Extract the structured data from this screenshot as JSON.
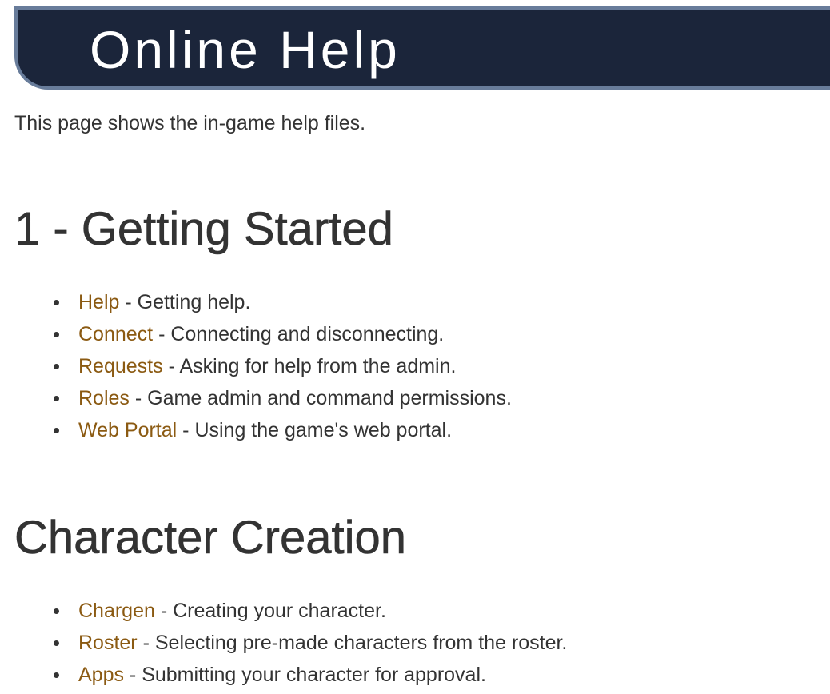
{
  "header": {
    "title": "Online Help"
  },
  "intro": "This page shows the in-game help files.",
  "sections": [
    {
      "heading": "1 - Getting Started",
      "items": [
        {
          "link": "Help",
          "sep": " - ",
          "desc": "Getting help."
        },
        {
          "link": "Connect",
          "sep": " - ",
          "desc": "Connecting and disconnecting."
        },
        {
          "link": "Requests",
          "sep": " - ",
          "desc": "Asking for help from the admin."
        },
        {
          "link": "Roles",
          "sep": " - ",
          "desc": "Game admin and command permissions."
        },
        {
          "link": "Web Portal",
          "sep": " - ",
          "desc": "Using the game's web portal."
        }
      ]
    },
    {
      "heading": "Character Creation",
      "items": [
        {
          "link": "Chargen",
          "sep": " - ",
          "desc": "Creating your character."
        },
        {
          "link": "Roster",
          "sep": " - ",
          "desc": "Selecting pre-made characters from the roster."
        },
        {
          "link": "Apps",
          "sep": " - ",
          "desc": "Submitting your character for approval."
        }
      ]
    }
  ],
  "colors": {
    "banner_bg": "#1b253a",
    "banner_border": "#687c9a",
    "link": "#8b5a12",
    "text": "#333333"
  }
}
